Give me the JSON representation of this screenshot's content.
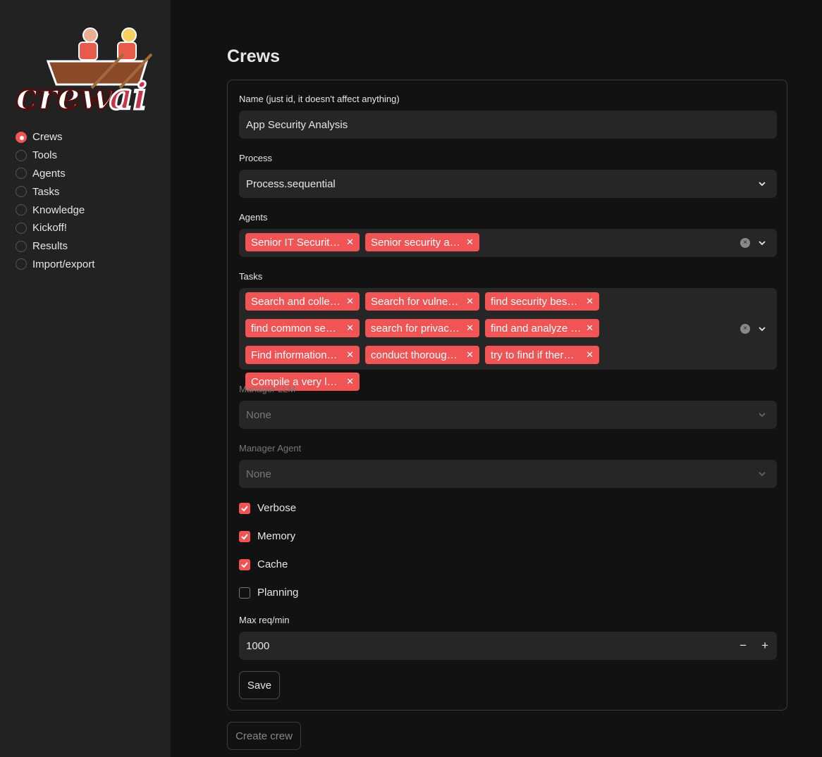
{
  "logo": {
    "text": "crewai"
  },
  "sidebar": {
    "items": [
      {
        "label": "Crews",
        "selected": true
      },
      {
        "label": "Tools",
        "selected": false
      },
      {
        "label": "Agents",
        "selected": false
      },
      {
        "label": "Tasks",
        "selected": false
      },
      {
        "label": "Knowledge",
        "selected": false
      },
      {
        "label": "Kickoff!",
        "selected": false
      },
      {
        "label": "Results",
        "selected": false
      },
      {
        "label": "Import/export",
        "selected": false
      }
    ]
  },
  "page": {
    "title": "Crews"
  },
  "form": {
    "name_label": "Name (just id, it doesn't affect anything)",
    "name_value": "App Security Analysis",
    "process_label": "Process",
    "process_value": "Process.sequential",
    "agents_label": "Agents",
    "agents": [
      "Senior IT Securit…",
      "Senior security a…"
    ],
    "tasks_label": "Tasks",
    "tasks": [
      "Search and colle…",
      "Search for vulne…",
      "find security bes…",
      "find common se…",
      "search for privac…",
      "find and analyze …",
      "Find information…",
      "conduct thoroug…",
      "try to find if ther…",
      "Compile a very l…"
    ],
    "manager_llm_label": "Manager LLM",
    "manager_llm_value": "None",
    "manager_agent_label": "Manager Agent",
    "manager_agent_value": "None",
    "checkboxes": [
      {
        "label": "Verbose",
        "checked": true
      },
      {
        "label": "Memory",
        "checked": true
      },
      {
        "label": "Cache",
        "checked": true
      },
      {
        "label": "Planning",
        "checked": false
      }
    ],
    "max_req_label": "Max req/min",
    "max_req_value": "1000",
    "save_label": "Save"
  },
  "create_crew_label": "Create crew",
  "colors": {
    "accent": "#f05454",
    "sidebar": "#222222",
    "background": "#121212"
  }
}
